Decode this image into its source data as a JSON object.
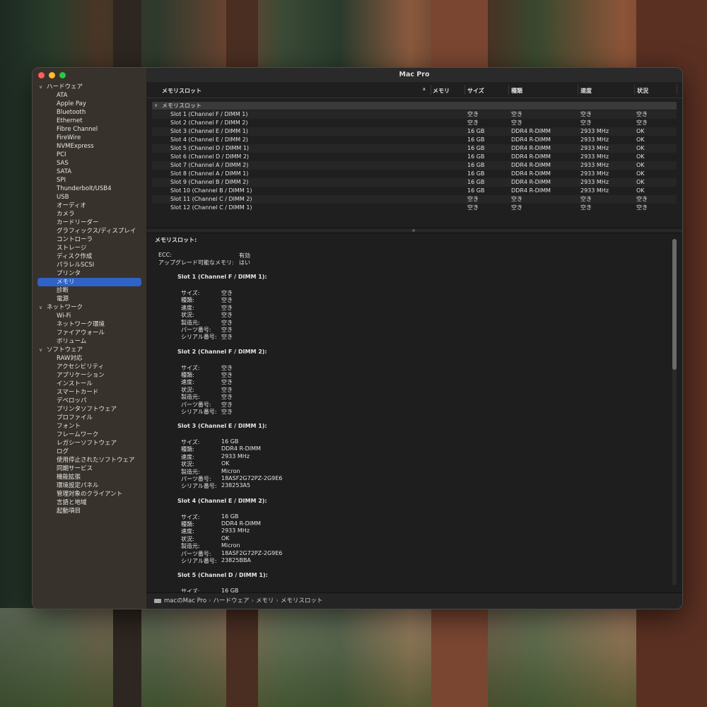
{
  "window": {
    "title": "Mac Pro"
  },
  "sidebar": {
    "groups": [
      {
        "label": "ハードウェア",
        "items": [
          "ATA",
          "Apple Pay",
          "Bluetooth",
          "Ethernet",
          "Fibre Channel",
          "FireWire",
          "NVMExpress",
          "PCI",
          "SAS",
          "SATA",
          "SPI",
          "Thunderbolt/USB4",
          "USB",
          "オーディオ",
          "カメラ",
          "カードリーダー",
          "グラフィックス/ディスプレイ",
          "コントローラ",
          "ストレージ",
          "ディスク作成",
          "パラレルSCSI",
          "プリンタ",
          "メモリ",
          "診断",
          "電源"
        ]
      },
      {
        "label": "ネットワーク",
        "items": [
          "Wi-Fi",
          "ネットワーク環境",
          "ファイアウォール",
          "ボリューム"
        ]
      },
      {
        "label": "ソフトウェア",
        "items": [
          "RAW対応",
          "アクセシビリティ",
          "アプリケーション",
          "インストール",
          "スマートカード",
          "デベロッパ",
          "プリンタソフトウェア",
          "プロファイル",
          "フォント",
          "フレームワーク",
          "レガシーソフトウェア",
          "ログ",
          "使用停止されたソフトウェア",
          "同期サービス",
          "機能拡張",
          "環境設定パネル",
          "管理対象のクライアント",
          "言語と地域",
          "起動項目"
        ]
      }
    ],
    "selected": "メモリ"
  },
  "table": {
    "headers": {
      "name": "メモリスロット",
      "memory": "メモリ",
      "size": "サイズ",
      "type": "種類",
      "speed": "速度",
      "status": "状況"
    },
    "group": "メモリスロット",
    "rows": [
      {
        "name": "Slot 1 (Channel F / DIMM 1)",
        "size": "空き",
        "type": "空き",
        "speed": "空き",
        "status": "空き"
      },
      {
        "name": "Slot 2 (Channel F / DIMM 2)",
        "size": "空き",
        "type": "空き",
        "speed": "空き",
        "status": "空き"
      },
      {
        "name": "Slot 3 (Channel E / DIMM 1)",
        "size": "16 GB",
        "type": "DDR4 R-DIMM",
        "speed": "2933 MHz",
        "status": "OK"
      },
      {
        "name": "Slot 4 (Channel E / DIMM 2)",
        "size": "16 GB",
        "type": "DDR4 R-DIMM",
        "speed": "2933 MHz",
        "status": "OK"
      },
      {
        "name": "Slot 5 (Channel D / DIMM 1)",
        "size": "16 GB",
        "type": "DDR4 R-DIMM",
        "speed": "2933 MHz",
        "status": "OK"
      },
      {
        "name": "Slot 6 (Channel D / DIMM 2)",
        "size": "16 GB",
        "type": "DDR4 R-DIMM",
        "speed": "2933 MHz",
        "status": "OK"
      },
      {
        "name": "Slot 7 (Channel A / DIMM 2)",
        "size": "16 GB",
        "type": "DDR4 R-DIMM",
        "speed": "2933 MHz",
        "status": "OK"
      },
      {
        "name": "Slot 8 (Channel A / DIMM 1)",
        "size": "16 GB",
        "type": "DDR4 R-DIMM",
        "speed": "2933 MHz",
        "status": "OK"
      },
      {
        "name": "Slot 9 (Channel B / DIMM 2)",
        "size": "16 GB",
        "type": "DDR4 R-DIMM",
        "speed": "2933 MHz",
        "status": "OK"
      },
      {
        "name": "Slot 10 (Channel B / DIMM 1)",
        "size": "16 GB",
        "type": "DDR4 R-DIMM",
        "speed": "2933 MHz",
        "status": "OK"
      },
      {
        "name": "Slot 11 (Channel C / DIMM 2)",
        "size": "空き",
        "type": "空き",
        "speed": "空き",
        "status": "空き"
      },
      {
        "name": "Slot 12 (Channel C / DIMM 1)",
        "size": "空き",
        "type": "空き",
        "speed": "空き",
        "status": "空き"
      }
    ]
  },
  "detail": {
    "heading": "メモリスロット:",
    "ecc_label": "ECC:",
    "ecc_value": "有効",
    "upgradable_label": "アップグレード可能なメモリ:",
    "upgradable_value": "はい",
    "field_labels": {
      "size": "サイズ:",
      "type": "種類:",
      "speed": "速度:",
      "status": "状況:",
      "manufacturer": "製造元:",
      "part": "パーツ番号:",
      "serial": "シリアル番号:"
    },
    "slots": [
      {
        "title": "Slot 1 (Channel F / DIMM 1):",
        "size": "空き",
        "type": "空き",
        "speed": "空き",
        "status": "空き",
        "manufacturer": "空き",
        "part": "空き",
        "serial": "空き"
      },
      {
        "title": "Slot 2 (Channel F / DIMM 2):",
        "size": "空き",
        "type": "空き",
        "speed": "空き",
        "status": "空き",
        "manufacturer": "空き",
        "part": "空き",
        "serial": "空き"
      },
      {
        "title": "Slot 3 (Channel E / DIMM 1):",
        "size": "16 GB",
        "type": "DDR4 R-DIMM",
        "speed": "2933 MHz",
        "status": "OK",
        "manufacturer": "Micron",
        "part": "18ASF2G72PZ-2G9E6",
        "serial": "238253A5"
      },
      {
        "title": "Slot 4 (Channel E / DIMM 2):",
        "size": "16 GB",
        "type": "DDR4 R-DIMM",
        "speed": "2933 MHz",
        "status": "OK",
        "manufacturer": "Micron",
        "part": "18ASF2G72PZ-2G9E6",
        "serial": "23825BBA"
      },
      {
        "title": "Slot 5 (Channel D / DIMM 1):",
        "size": "16 GB"
      }
    ]
  },
  "pathbar": {
    "items": [
      "macのMac Pro",
      "ハードウェア",
      "メモリ",
      "メモリスロット"
    ]
  }
}
